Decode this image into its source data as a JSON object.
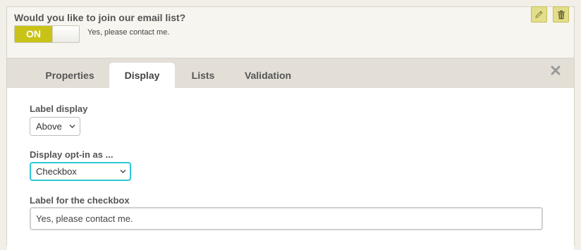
{
  "question": {
    "title": "Would you like to join our email list?",
    "toggle_state": "ON",
    "toggle_text": "Yes, please contact me."
  },
  "actions": {
    "edit_icon": "pencil-icon",
    "delete_icon": "trash-icon",
    "button_color": "#e3de8a"
  },
  "tabs": [
    {
      "label": "Properties",
      "active": false
    },
    {
      "label": "Display",
      "active": true
    },
    {
      "label": "Lists",
      "active": false
    },
    {
      "label": "Validation",
      "active": false
    }
  ],
  "close_icon": "close-x-icon",
  "fields": {
    "label_display": {
      "label": "Label display",
      "value": "Above"
    },
    "display_optin": {
      "label": "Display opt-in as ...",
      "value": "Checkbox"
    },
    "checkbox_label": {
      "label": "Label for the checkbox",
      "value": "Yes, please contact me."
    }
  },
  "colors": {
    "toggle_on": "#c9c317",
    "focus_ring": "#2fc7d6"
  }
}
